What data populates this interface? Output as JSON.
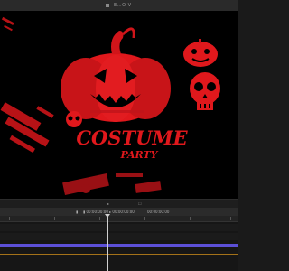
{
  "window": {
    "title": "E…O V"
  },
  "viewer": {
    "poster_headline": "COSTUME",
    "poster_subline": "PARTY",
    "accent_color": "#e0181c",
    "background_color": "#000000"
  },
  "viewer_bar": {
    "play_icon": "play-icon",
    "zoom_label": "☐"
  },
  "timeline": {
    "header_left": "▮",
    "header_center": "▮  00:00:00:00 ▸ 00:00:00:00",
    "header_right": "00:00:00:00",
    "track_color": "#5b4fd6",
    "marker_color": "#c88a1a"
  }
}
